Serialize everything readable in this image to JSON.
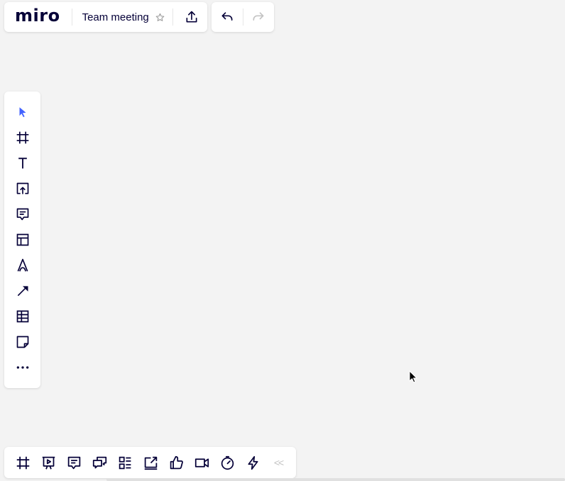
{
  "app": {
    "logo_text": "miro"
  },
  "board": {
    "title": "Team meeting"
  },
  "top_toolbar": {
    "icons": [
      "star-icon",
      "upload-icon"
    ],
    "history": [
      "undo-icon",
      "redo-icon"
    ]
  },
  "left_toolbar": {
    "tools": [
      "select-cursor-icon",
      "frame-icon",
      "text-icon",
      "upload-icon",
      "comment-icon",
      "template-icon",
      "pen-icon",
      "arrow-icon",
      "table-icon",
      "sticky-note-icon",
      "more-icon"
    ],
    "active": "select-cursor-icon"
  },
  "bottom_toolbar": {
    "tools": [
      "frames-icon",
      "presentation-icon",
      "comments-icon",
      "chat-icon",
      "card-list-icon",
      "share-screen-icon",
      "voting-icon",
      "video-call-icon",
      "timer-icon",
      "activity-icon"
    ],
    "collapse_label": "<<"
  },
  "colors": {
    "canvas": "#f3f3f3",
    "panel": "#ffffff",
    "ink": "#050038",
    "active_tool": "#4262ff",
    "disabled": "#c3c3c3"
  }
}
